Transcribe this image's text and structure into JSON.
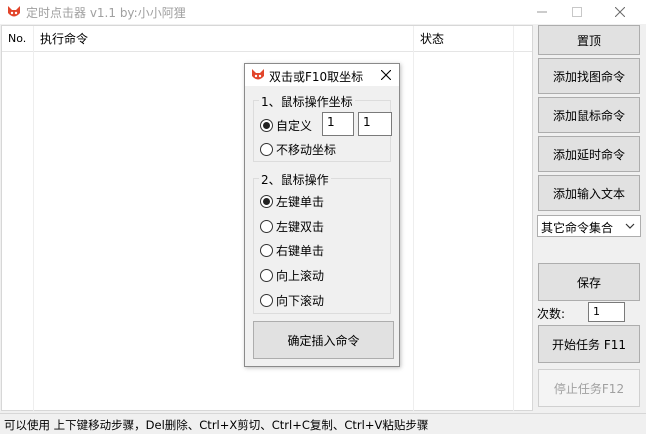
{
  "window": {
    "title": "定时点击器 v1.1 by:小小阿狸"
  },
  "list": {
    "columns": [
      "No.",
      "执行命令",
      "状态"
    ]
  },
  "buttons": {
    "top": "置顶",
    "add_image": "添加找图命令",
    "add_mouse": "添加鼠标命令",
    "add_delay": "添加延时命令",
    "add_text": "添加输入文本",
    "save": "保存",
    "start": "开始任务 F11",
    "stop": "停止任务F12"
  },
  "combo": {
    "selected": "其它命令集合"
  },
  "count": {
    "label": "次数:",
    "value": "1"
  },
  "status_bar": {
    "text": "可以使用 上下键移动步骤，Del删除、Ctrl+X剪切、Ctrl+C复制、Ctrl+V粘贴步骤"
  },
  "dialog": {
    "title": "双击或F10取坐标",
    "group1": {
      "label": "1、鼠标操作坐标",
      "custom_label": "自定义",
      "x": "1",
      "y": "1",
      "no_move_label": "不移动坐标",
      "selected": "custom"
    },
    "group2": {
      "label": "2、鼠标操作",
      "options": [
        "左键单击",
        "左键双击",
        "右键单击",
        "向上滚动",
        "向下滚动"
      ],
      "selected_index": 0
    },
    "confirm": "确定插入命令"
  }
}
